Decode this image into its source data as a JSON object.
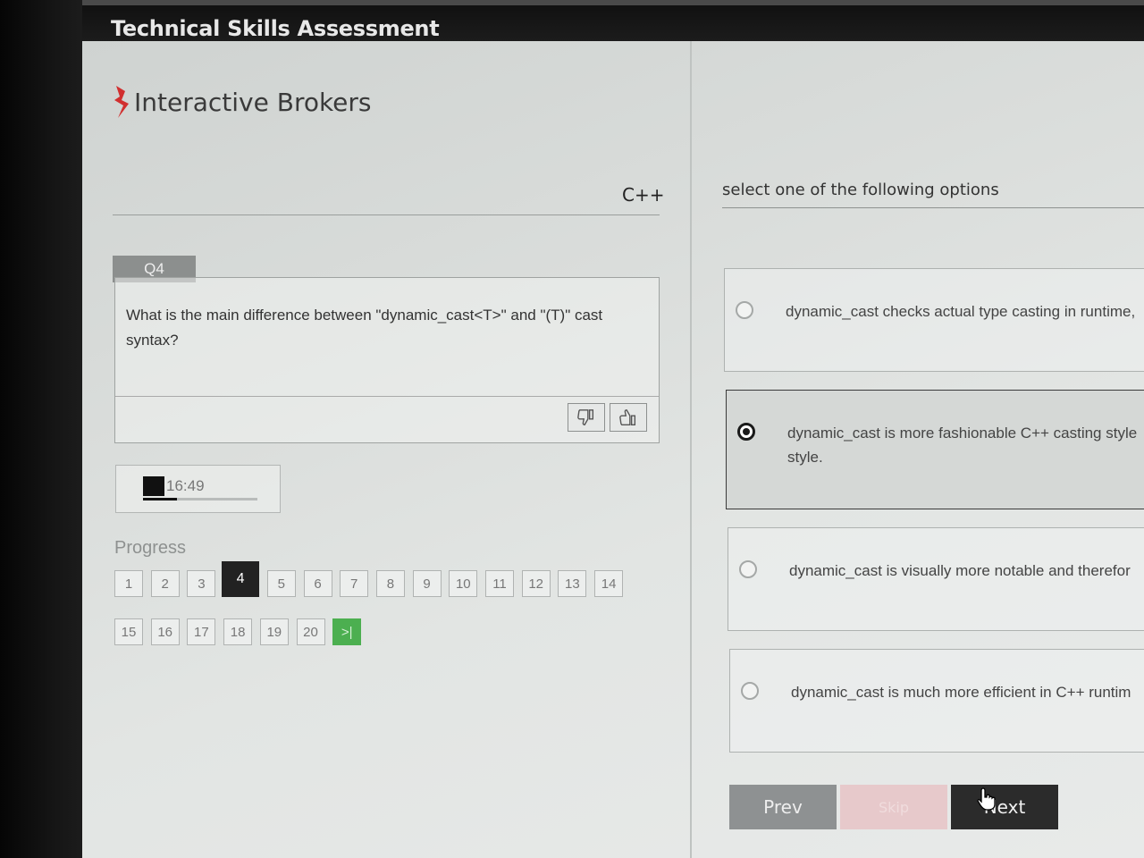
{
  "window": {
    "title": "Technical Skills Assessment"
  },
  "brand": {
    "name": "Interactive Brokers",
    "accent": "#d12f2f"
  },
  "subject": "C++",
  "question": {
    "label": "Q4",
    "text": "What is the main difference between \"dynamic_cast<T>\" and \"(T)\" cast syntax?"
  },
  "timer": {
    "time": "16:49",
    "progress_fraction": 0.3
  },
  "progress": {
    "label": "Progress",
    "pages": [
      "1",
      "2",
      "3",
      "4",
      "5",
      "6",
      "7",
      "8",
      "9",
      "10",
      "11",
      "12",
      "13",
      "14",
      "15",
      "16",
      "17",
      "18",
      "19",
      "20"
    ],
    "current": "4",
    "last_label": ">|"
  },
  "answers": {
    "instruction": "select one of the following options",
    "options": [
      {
        "text": "dynamic_cast checks actual type casting in runtime,",
        "selected": false
      },
      {
        "text": "dynamic_cast is more fashionable C++ casting style style.",
        "selected": true
      },
      {
        "text": "dynamic_cast is visually more notable and therefor",
        "selected": false
      },
      {
        "text": "dynamic_cast is much more efficient in C++ runtim",
        "selected": false
      }
    ]
  },
  "nav": {
    "prev": "Prev",
    "skip": "Skip",
    "next": "Next"
  },
  "colors": {
    "selected_border": "#3a3a3a",
    "last_page": "#4caf50",
    "next_bg": "#2b2b2b"
  }
}
